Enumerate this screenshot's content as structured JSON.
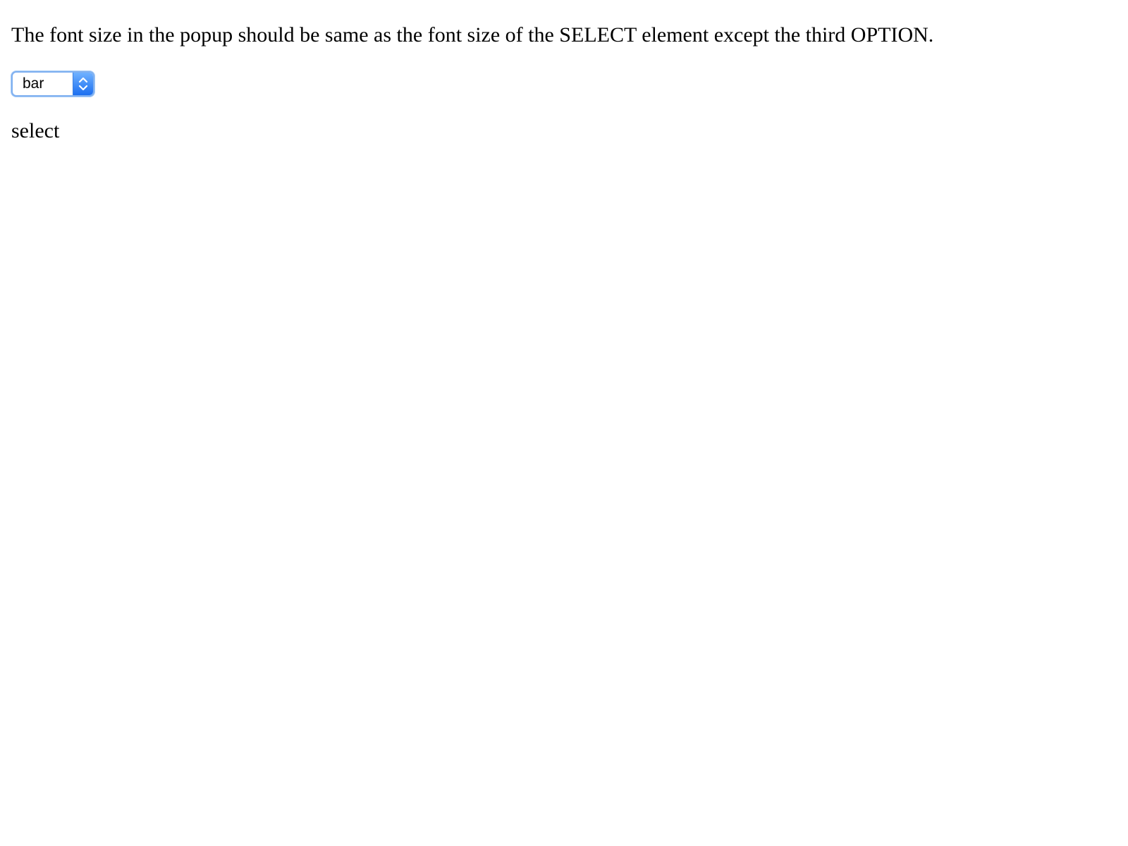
{
  "instruction": {
    "text": "The font size in the popup should be same as the font size of the SELECT element except the third OPTION."
  },
  "select": {
    "selected_value": "bar",
    "arrow_icon": "chevron-up-down-icon",
    "accent_color": "#1c6ff0"
  },
  "caption": {
    "text": "select"
  }
}
